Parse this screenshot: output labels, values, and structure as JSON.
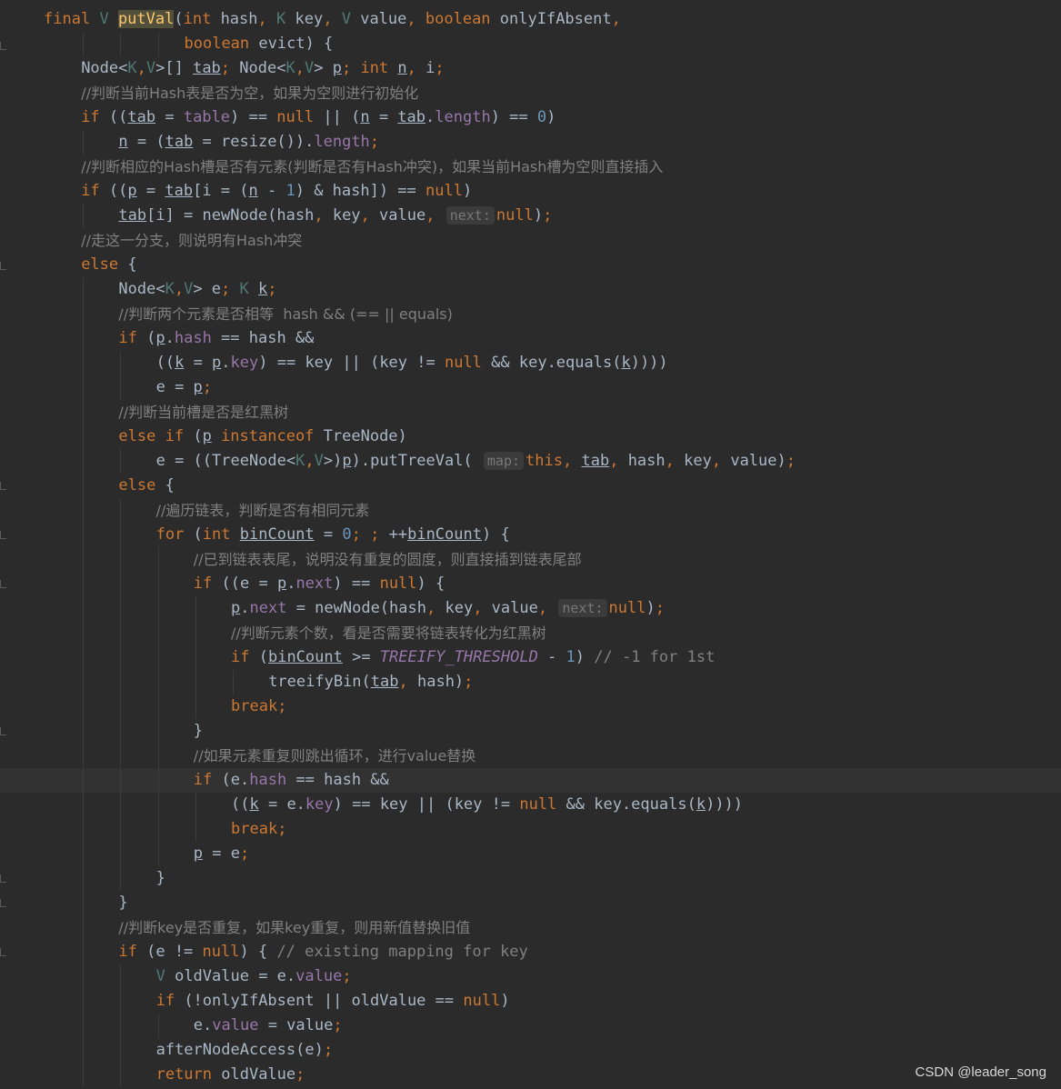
{
  "editor": {
    "lines": [
      "final V putVal(int hash, K key, V value, boolean onlyIfAbsent,",
      "               boolean evict) {",
      "    Node<K,V>[] tab; Node<K,V> p; int n, i;",
      "    //判断当前Hash表是否为空，如果为空则进行初始化",
      "    if ((tab = table) == null || (n = tab.length) == 0)",
      "        n = (tab = resize()).length;",
      "    //判断相应的Hash槽是否有元素(判断是否有Hash冲突)，如果当前Hash槽为空则直接插入",
      "    if ((p = tab[i = (n - 1) & hash]) == null)",
      "        tab[i] = newNode(hash, key, value, next: null);",
      "    //走这一分支，则说明有Hash冲突",
      "    else {",
      "        Node<K,V> e; K k;",
      "        //判断两个元素是否相等  hash && (== || equals)",
      "        if (p.hash == hash &&",
      "            ((k = p.key) == key || (key != null && key.equals(k))))",
      "            e = p;",
      "        //判断当前槽是否是红黑树",
      "        else if (p instanceof TreeNode)",
      "            e = ((TreeNode<K,V>)p).putTreeVal( map: this, tab, hash, key, value);",
      "        else {",
      "            //遍历链表，判断是否有相同元素",
      "            for (int binCount = 0; ; ++binCount) {",
      "                //已到链表表尾，说明没有重复的圆度，则直接插到链表尾部",
      "                if ((e = p.next) == null) {",
      "                    p.next = newNode(hash, key, value, next: null);",
      "                    //判断元素个数，看是否需要将链表转化为红黑树",
      "                    if (binCount >= TREEIFY_THRESHOLD - 1) // -1 for 1st",
      "                        treeifyBin(tab, hash);",
      "                    break;",
      "                }",
      "                //如果元素重复则跳出循环，进行value替换",
      "                if (e.hash == hash &&",
      "                    ((k = e.key) == key || (key != null && key.equals(k))))",
      "                    break;",
      "                p = e;",
      "            }",
      "        }",
      "        //判断key是否重复，如果key重复，则用新值替换旧值",
      "        if (e != null) { // existing mapping for key",
      "            V oldValue = e.value;",
      "            if (!onlyIfAbsent || oldValue == null)",
      "                e.value = value;",
      "            afterNodeAccess(e);",
      "            return oldValue;"
    ],
    "caret_line": 31
  },
  "colors": {
    "background": "#2b2b2b",
    "keyword": "#cc7832",
    "type_param": "#507874",
    "field": "#9876aa",
    "comment": "#808080",
    "number": "#6897bb",
    "method_decl": "#ffc66d",
    "text": "#a9b7c6"
  },
  "gutter": {
    "intention_icon": "lightbulb-icon"
  },
  "watermark": "CSDN @leader_song"
}
